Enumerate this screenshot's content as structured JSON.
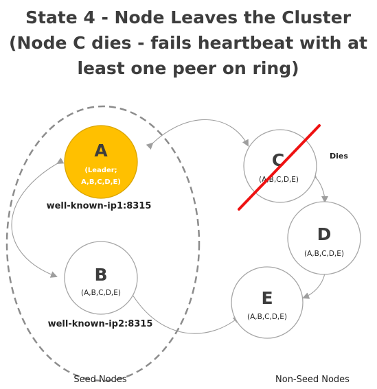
{
  "title": {
    "line1": "State 4 - Node Leaves the Cluster",
    "line2": "(Node C dies - fails heartbeat with at",
    "line3": "least one peer on ring)"
  },
  "nodes": {
    "a": {
      "letter": "A",
      "leader_line1": "(Leader;",
      "leader_line2": "A,B,C,D,E)",
      "address": "well-known-ip1:8315"
    },
    "b": {
      "letter": "B",
      "members": "(A,B,C,D,E)",
      "address": "well-known-ip2:8315"
    },
    "c": {
      "letter": "C",
      "members": "(A,B,C,D,E)",
      "status": "Dies"
    },
    "d": {
      "letter": "D",
      "members": "(A,B,C,D,E)"
    },
    "e": {
      "letter": "E",
      "members": "(A,B,C,D,E)"
    }
  },
  "groups": {
    "seed": "Seed Nodes",
    "non_seed": "Non-Seed Nodes"
  },
  "colors": {
    "leader_fill": "#ffc000",
    "node_stroke": "#a6a6a6",
    "dead_strike": "#ee1111",
    "arrow": "#9e9e9e",
    "seed_group_border": "#8c8c8c",
    "text": "#3d3d3d"
  }
}
